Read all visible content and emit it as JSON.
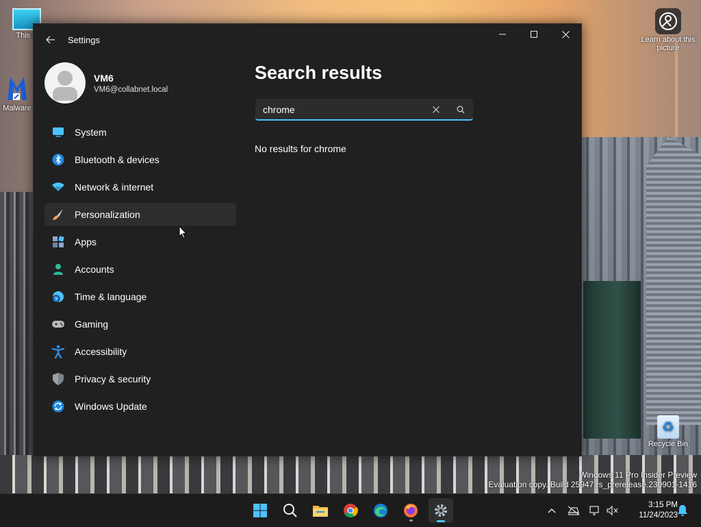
{
  "desktop": {
    "icons": {
      "this_pc": "This P",
      "malwarebytes": "Malware",
      "learn": "Learn about this picture",
      "recycle_bin": "Recycle Bin"
    },
    "watermark": {
      "line1": "Windows 11 Pro Insider Preview",
      "line2": "Evaluation copy. Build 25947.rs_prerelease.230901-1416"
    }
  },
  "window": {
    "title": "Settings",
    "controls": {
      "minimize": "—",
      "maximize": "☐",
      "close": "✕"
    }
  },
  "profile": {
    "name": "VM6",
    "email": "VM6@collabnet.local"
  },
  "nav": {
    "items": [
      {
        "label": "System",
        "icon": "monitor-icon",
        "color": "#4cc2ff"
      },
      {
        "label": "Bluetooth & devices",
        "icon": "bluetooth-icon",
        "color": "#1e88e5"
      },
      {
        "label": "Network & internet",
        "icon": "wifi-icon",
        "color": "#4cc2ff"
      },
      {
        "label": "Personalization",
        "icon": "brush-icon",
        "color": "#f0a060"
      },
      {
        "label": "Apps",
        "icon": "apps-icon",
        "color": "#8fa8c8"
      },
      {
        "label": "Accounts",
        "icon": "person-icon",
        "color": "#2fb99a"
      },
      {
        "label": "Time & language",
        "icon": "globe-clock-icon",
        "color": "#4cc2ff"
      },
      {
        "label": "Gaming",
        "icon": "gamepad-icon",
        "color": "#bbbbbb"
      },
      {
        "label": "Accessibility",
        "icon": "accessibility-icon",
        "color": "#2f8fe0"
      },
      {
        "label": "Privacy & security",
        "icon": "shield-icon",
        "color": "#9aa0a6"
      },
      {
        "label": "Windows Update",
        "icon": "update-icon",
        "color": "#1e88e5"
      }
    ],
    "active": "Personalization"
  },
  "main": {
    "title": "Search results",
    "search": {
      "value": "chrome",
      "placeholder": ""
    },
    "no_results": "No results for chrome"
  },
  "taskbar": {
    "apps": [
      "start-icon",
      "search-icon",
      "file-explorer-icon",
      "chrome-icon",
      "edge-icon",
      "firefox-icon",
      "settings-icon"
    ],
    "clock": {
      "time": "3:15 PM",
      "date": "11/24/2023"
    }
  },
  "colors": {
    "accent": "#4cc2ff",
    "window_bg": "#202020",
    "active_item_bg": "#2d2d2d"
  }
}
